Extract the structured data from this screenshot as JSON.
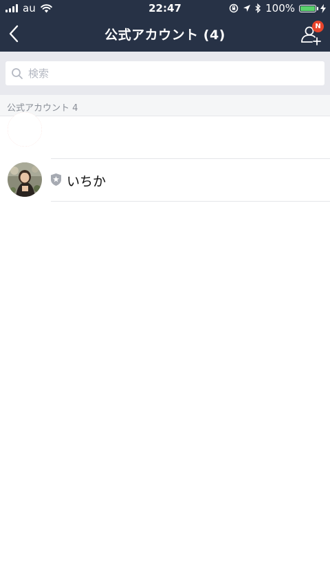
{
  "status": {
    "carrier": "au",
    "time": "22:47",
    "battery": "100%",
    "battery_level": 1.0,
    "battery_color": "#5ad26b"
  },
  "header": {
    "title": "公式アカウント (4)",
    "badge": "N",
    "background": "#273246",
    "badge_color": "#e8452c"
  },
  "search": {
    "placeholder": "検索"
  },
  "section": {
    "label": "公式アカウント 4"
  },
  "accounts": [
    {
      "name": "",
      "avatar_color": "#e8452c"
    },
    {
      "name": "いちか",
      "verified": true
    }
  ]
}
